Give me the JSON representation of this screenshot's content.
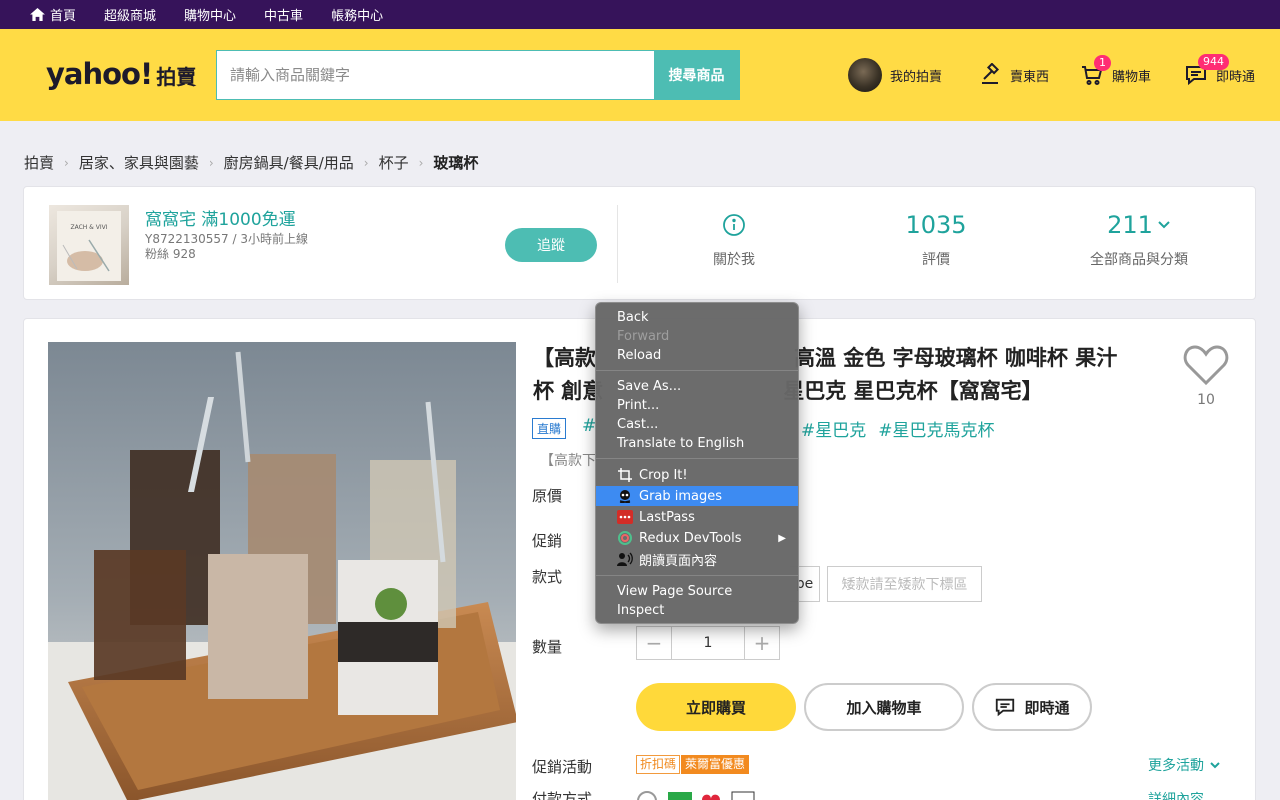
{
  "topnav": {
    "items": [
      "首頁",
      "超級商城",
      "購物中心",
      "中古車",
      "帳務中心"
    ]
  },
  "header": {
    "logo_main": "yahoo!",
    "logo_sub": "拍賣",
    "search_placeholder": "請輸入商品關鍵字",
    "search_button": "搜尋商品",
    "my_auction": "我的拍賣",
    "sell": "賣東西",
    "cart": "購物車",
    "cart_count": "1",
    "messenger": "即時通",
    "messenger_count": "944"
  },
  "breadcrumb": [
    "拍賣",
    "居家、家具與園藝",
    "廚房鍋具/餐具/用品",
    "杯子",
    "玻璃杯"
  ],
  "seller": {
    "thumb_text": "ZACH & VIVI",
    "name": "窩窩宅 滿1000免運",
    "id_line": "Y8722130557 / 3小時前上線",
    "fans_line": "粉絲 928",
    "follow": "追蹤",
    "about": "關於我",
    "rating_value": "1035",
    "rating_label": "評價",
    "products_value": "211",
    "products_label": "全部商品與分類"
  },
  "product": {
    "title_line1": "【高款",
    "title_line1b": "高溫 金色 字母玻璃杯 咖啡杯 果汁",
    "title_line2": "杯 創意",
    "title_line2b": "星巴克 星巴克杯【窩窩宅】",
    "favorites": "10",
    "direct_tag": "直購",
    "hashtag_partial": "#",
    "hashtags": [
      "#星巴克",
      "#星巴克馬克杯"
    ],
    "subtitle": "【高款下",
    "original_price_label": "原價",
    "promo_label": "促銷",
    "variant_label": "款式",
    "variant_partial": "pe",
    "variant_note": "矮款請至矮款下標區",
    "qty_label": "數量",
    "qty_value": "1",
    "buy_now": "立即購買",
    "add_cart": "加入購物車",
    "chat": "即時通",
    "promo_activity_label": "促銷活動",
    "promo_tag_1": "折扣碼",
    "promo_tag_2": "萊爾富優惠",
    "more_activities": "更多活動",
    "payment_label": "付款方式",
    "detail_link": "詳細內容"
  },
  "context_menu": {
    "back": "Back",
    "forward": "Forward",
    "reload": "Reload",
    "save_as": "Save As...",
    "print": "Print...",
    "cast": "Cast...",
    "translate": "Translate to English",
    "crop_it": "Crop It!",
    "grab_images": "Grab images",
    "lastpass": "LastPass",
    "redux": "Redux DevTools",
    "read_aloud": "朗讀頁面內容",
    "view_source": "View Page Source",
    "inspect": "Inspect"
  },
  "colors": {
    "topnav_bg": "#36135a",
    "header_bg": "#ffdb45",
    "accent_teal": "#4dbdb3",
    "menu_highlight": "#3d8bf2"
  }
}
